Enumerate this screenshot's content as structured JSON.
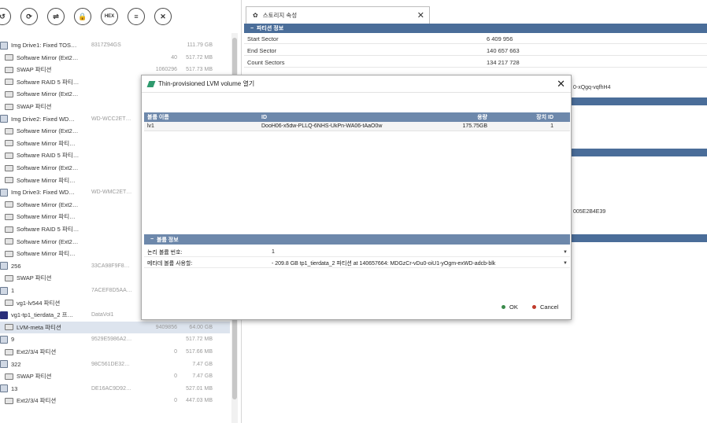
{
  "toolbar": {
    "buttons": [
      {
        "icon": "open-icon",
        "glyph": "↺"
      },
      {
        "icon": "refresh-icon",
        "glyph": "⟳"
      },
      {
        "icon": "link-icon",
        "glyph": "⇌"
      },
      {
        "icon": "lock-icon",
        "glyph": "🔒"
      },
      {
        "icon": "hex-icon",
        "glyph": "HEX"
      },
      {
        "icon": "list-icon",
        "glyph": "≡"
      },
      {
        "icon": "close-icon",
        "glyph": "✕"
      }
    ]
  },
  "tree": {
    "rows": [
      {
        "type": "disk",
        "name": "Img Drive1: Fixed TOS…",
        "id": "8317Z94GS",
        "num": "",
        "size": "111.79 GB"
      },
      {
        "type": "part",
        "name": "Software Mirror (Ext2…",
        "id": "",
        "num": "40",
        "size": "517.72 MB"
      },
      {
        "type": "part",
        "name": "SWAP 파티션",
        "id": "",
        "num": "1060296",
        "size": "517.73 MB"
      },
      {
        "type": "part",
        "name": "Software RAID 5 파티…",
        "id": "",
        "num": "",
        "size": ""
      },
      {
        "type": "part",
        "name": "Software Mirror (Ext2…",
        "id": "",
        "num": "",
        "size": ""
      },
      {
        "type": "part",
        "name": "SWAP 파티션",
        "id": "",
        "num": "",
        "size": ""
      },
      {
        "type": "disk",
        "name": "Img Drive2: Fixed WD…",
        "id": "WD-WCC2ET…",
        "num": "",
        "size": ""
      },
      {
        "type": "part",
        "name": "Software Mirror (Ext2…",
        "id": "",
        "num": "",
        "size": ""
      },
      {
        "type": "part",
        "name": "Software Mirror 파티…",
        "id": "",
        "num": "",
        "size": ""
      },
      {
        "type": "part",
        "name": "Software RAID 5 파티…",
        "id": "",
        "num": "",
        "size": ""
      },
      {
        "type": "part",
        "name": "Software Mirror (Ext2…",
        "id": "",
        "num": "",
        "size": ""
      },
      {
        "type": "part",
        "name": "Software Mirror 파티…",
        "id": "",
        "num": "",
        "size": ""
      },
      {
        "type": "disk",
        "name": "Img Drive3: Fixed WD…",
        "id": "WD-WMC2ET…",
        "num": "",
        "size": ""
      },
      {
        "type": "part",
        "name": "Software Mirror (Ext2…",
        "id": "",
        "num": "",
        "size": ""
      },
      {
        "type": "part",
        "name": "Software Mirror 파티…",
        "id": "",
        "num": "",
        "size": ""
      },
      {
        "type": "part",
        "name": "Software RAID 5 파티…",
        "id": "",
        "num": "",
        "size": ""
      },
      {
        "type": "part",
        "name": "Software Mirror (Ext2…",
        "id": "",
        "num": "",
        "size": ""
      },
      {
        "type": "part",
        "name": "Software Mirror 파티…",
        "id": "",
        "num": "",
        "size": ""
      },
      {
        "type": "disk",
        "name": "256",
        "id": "33CA98F9F8…",
        "num": "",
        "size": ""
      },
      {
        "type": "part",
        "name": "SWAP 파티션",
        "id": "",
        "num": "",
        "size": ""
      },
      {
        "type": "disk",
        "name": "1",
        "id": "7ACEF8D5AA…",
        "num": "",
        "size": ""
      },
      {
        "type": "part",
        "name": "vg1-lv544 파티션",
        "id": "",
        "num": "",
        "size": ""
      },
      {
        "type": "vol",
        "name": "vg1-tp1_tierdata_2 프…",
        "id": "DataVol1",
        "num": "",
        "size": ""
      },
      {
        "type": "part",
        "name": "LVM-meta 파티션",
        "id": "",
        "num": "9409856",
        "size": "64.00 GB",
        "selected": true
      },
      {
        "type": "disk",
        "name": "9",
        "id": "9529E5986A2…",
        "num": "",
        "size": "517.72 MB"
      },
      {
        "type": "part",
        "name": "Ext2/3/4 파티션",
        "id": "",
        "num": "0",
        "size": "517.66 MB"
      },
      {
        "type": "disk",
        "name": "322",
        "id": "98C561DE32…",
        "num": "",
        "size": "7.47 GB"
      },
      {
        "type": "part",
        "name": "SWAP 파티션",
        "id": "",
        "num": "0",
        "size": "7.47 GB"
      },
      {
        "type": "disk",
        "name": "13",
        "id": "DE16AC9D92…",
        "num": "",
        "size": "527.01 MB"
      },
      {
        "type": "part",
        "name": "Ext2/3/4 파티션",
        "id": "",
        "num": "0",
        "size": "447.03 MB"
      }
    ]
  },
  "tab": {
    "label": "스토리지 속성",
    "close": "✕"
  },
  "right": {
    "section_partition": "파티션 정보",
    "rows": [
      {
        "label": "Start Sector",
        "value": "6 409 956"
      },
      {
        "label": "End Sector",
        "value": "140 657 663"
      },
      {
        "label": "Count Sectors",
        "value": "134 217 728"
      }
    ],
    "frag_id": "0-xQgq-vqfhH4",
    "frag_hash": "005E2B4E39"
  },
  "dialog": {
    "title": "Thin-provisioned LVM volume 열기",
    "close": "✕",
    "table": {
      "headers": [
        "볼륨 이름",
        "ID",
        "용량",
        "장치 ID"
      ],
      "rows": [
        {
          "name": "lv1",
          "id": "DooH06-x5dw-PLLQ-6NHS-UkPn-WA06-tAaO0w",
          "size": "175.75GB",
          "dev": "1"
        }
      ]
    },
    "info_head": "볼륨 정보",
    "info": [
      {
        "label": "논리 볼륨 번호:",
        "value": "1"
      },
      {
        "label": "메타데 볼륨 사용할:",
        "value": "- 209.8 GB tp1_tierdata_2 파티션 at 140657664: MDGzCr-vDu0-oiU1-yOgm-exWD-adcb-blk"
      }
    ],
    "ok": "OK",
    "cancel": "Cancel",
    "ok_color": "#3a8a4a",
    "cancel_color": "#c03a2b"
  }
}
